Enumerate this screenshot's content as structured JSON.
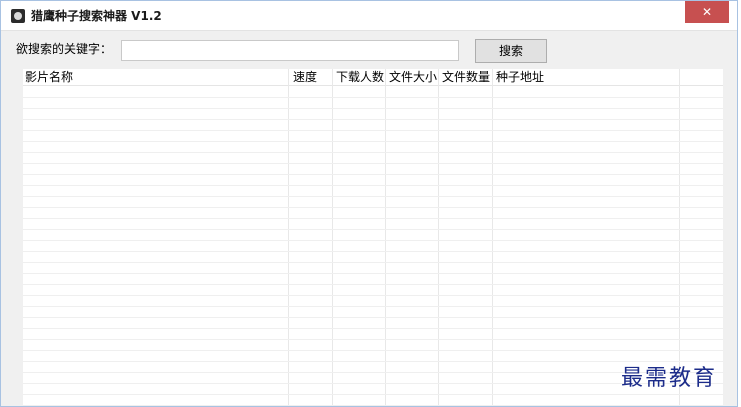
{
  "window": {
    "title": "猎鹰种子搜索神器 V1.2",
    "close_glyph": "✕"
  },
  "search": {
    "label": "欲搜索的关键字：",
    "value": "",
    "button_label": "搜索"
  },
  "table": {
    "columns": [
      "影片名称",
      "速度",
      "下载人数",
      "文件大小",
      "文件数量",
      "种子地址"
    ],
    "rows": []
  },
  "watermark": {
    "text": "最需教育"
  }
}
